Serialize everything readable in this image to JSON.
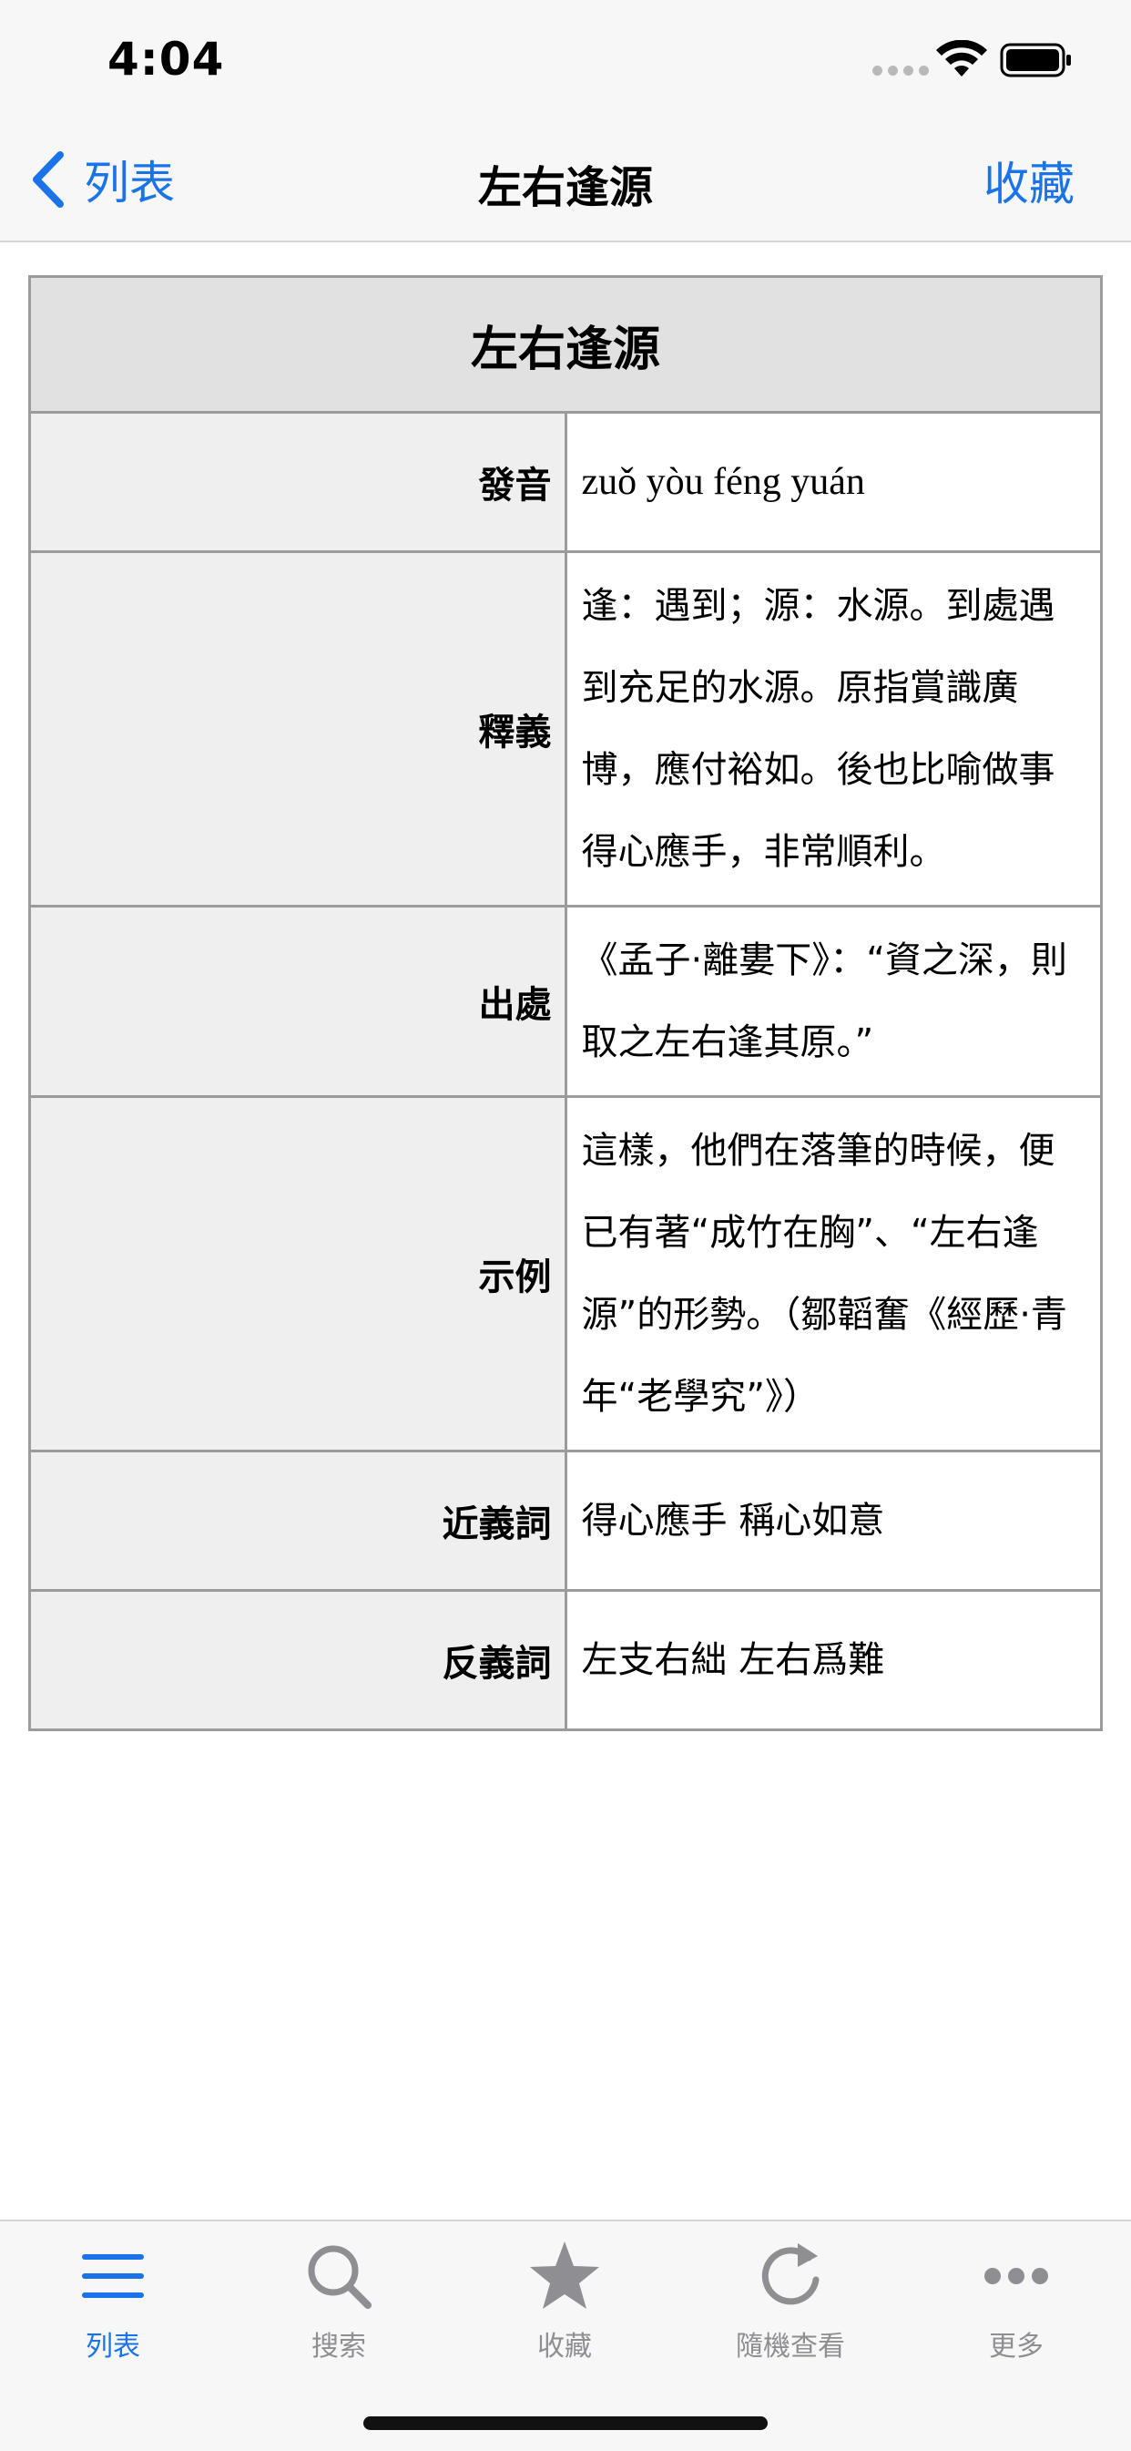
{
  "status": {
    "time": "4:04"
  },
  "nav": {
    "back_label": "列表",
    "title": "左右逢源",
    "action_label": "收藏"
  },
  "entry": {
    "title": "左右逢源",
    "rows": [
      {
        "label": "發音",
        "value": "zuǒ yòu féng yuán"
      },
      {
        "label": "釋義",
        "value": "逢：遇到；源：水源。到處遇到充足的水源。原指賞識廣博，應付裕如。後也比喻做事得心應手，非常順利。"
      },
      {
        "label": "出處",
        "value": "《孟子·離婁下》：“資之深，則取之左右逢其原。”"
      },
      {
        "label": "示例",
        "value": "這樣，他們在落筆的時候，便已有著“成竹在胸”、“左右逢源”的形勢。（鄒韜奮《經歷·青年“老學究”》）"
      },
      {
        "label": "近義詞",
        "value": "得心應手 稱心如意"
      },
      {
        "label": "反義詞",
        "value": "左支右絀 左右爲難"
      }
    ]
  },
  "tabs": [
    {
      "label": "列表",
      "icon": "list-icon",
      "active": true
    },
    {
      "label": "搜索",
      "icon": "search-icon",
      "active": false
    },
    {
      "label": "收藏",
      "icon": "star-icon",
      "active": false
    },
    {
      "label": "隨機查看",
      "icon": "refresh-icon",
      "active": false
    },
    {
      "label": "更多",
      "icon": "more-icon",
      "active": false
    }
  ],
  "colors": {
    "accent": "#1a73e8",
    "inactive": "#8e8e93",
    "header_bg": "#e1e1e1",
    "label_bg": "#efefef",
    "border": "#9b9b9b"
  }
}
